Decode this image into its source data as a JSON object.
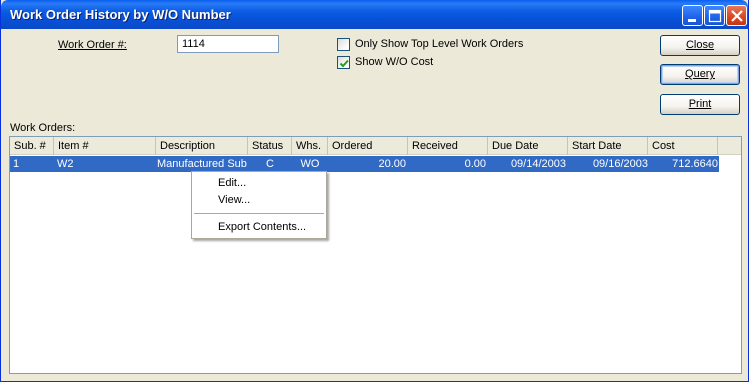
{
  "window": {
    "title": "Work Order History by W/O Number",
    "colors": {
      "titlebar": "#0a5ff0",
      "selection": "#316ac5",
      "face": "#ece9d8"
    }
  },
  "form": {
    "work_order_label": "Work Order #:",
    "work_order_value": "1114",
    "top_level_label": "Only Show Top Level Work Orders",
    "top_level_checked": false,
    "show_cost_label": "Show W/O Cost",
    "show_cost_checked": true,
    "work_orders_label": "Work Orders:"
  },
  "buttons": {
    "close": "Close",
    "query": "Query",
    "print": "Print"
  },
  "table": {
    "columns": [
      "Sub. #",
      "Item #",
      "Description",
      "Status",
      "Whs.",
      "Ordered",
      "Received",
      "Due Date",
      "Start Date",
      "Cost"
    ],
    "rows": [
      [
        "1",
        "W2",
        "Manufactured Sub",
        "C",
        "WO",
        "20.00",
        "0.00",
        "09/14/2003",
        "09/16/2003",
        "712.6640"
      ]
    ],
    "selected_row": 0
  },
  "context_menu": {
    "items": [
      "Edit...",
      "View...",
      "Export Contents..."
    ]
  }
}
